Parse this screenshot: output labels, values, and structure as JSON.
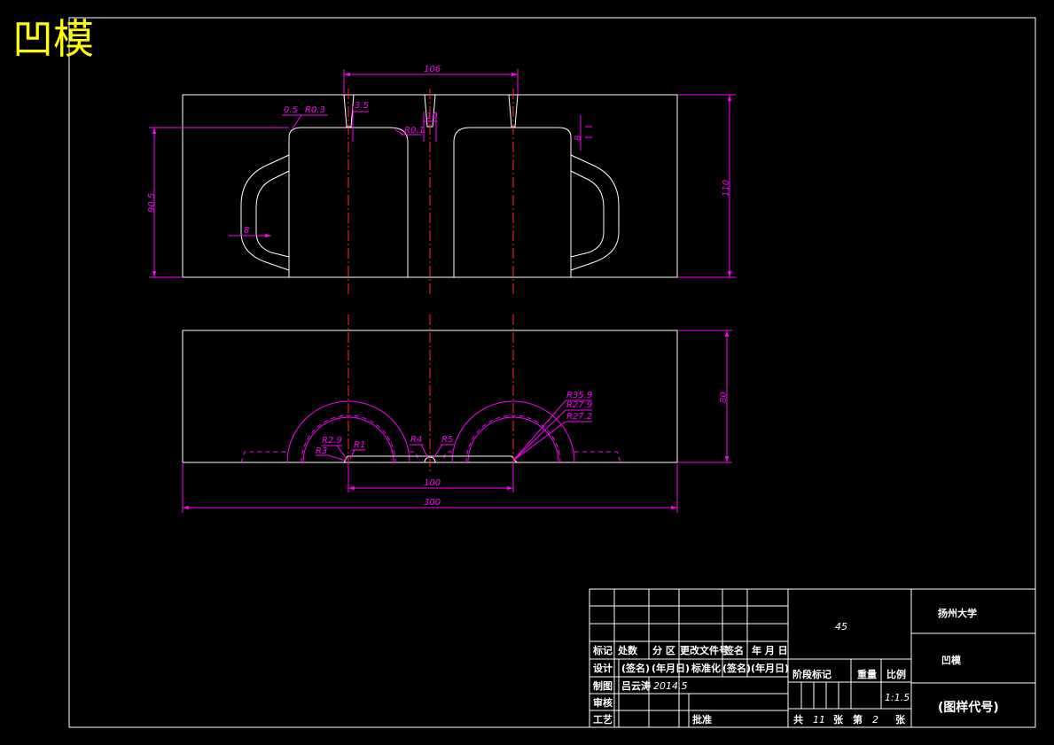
{
  "drawing_title": "凹模",
  "dimensions": {
    "top_width": "106",
    "chamfer": "0.5",
    "r_top": "R0.3",
    "gap_a": "3.5",
    "slot": "10",
    "r_small": "R0.1",
    "rim": "8",
    "height_left": "90.5",
    "height_right": "110",
    "handle": "8",
    "height_bottom": "80",
    "r_outer": "R35.9",
    "r_mid": "R27.9",
    "r_inner": "R27.2",
    "r29": "R2.9",
    "r1": "R1",
    "r3": "R3",
    "r4": "R4",
    "r5": "R5",
    "span": "100",
    "total": "300"
  },
  "title_block": {
    "material": "45",
    "university": "扬州大学",
    "part_name": "凹模",
    "drawing_code": "(图样代号)",
    "hdr_mark": "标记",
    "hdr_count": "处数",
    "hdr_zone": "分 区",
    "hdr_docno": "更改文件号",
    "hdr_sign": "签名",
    "hdr_date": "年 月 日",
    "design_label": "设计",
    "sign_name": "(签名)",
    "ymd": "(年月日)",
    "standard_label": "标准化",
    "sign_name2": "(签名)",
    "ymd2": "(年月日)",
    "drawn_label": "制图",
    "drawn_name": "吕云涛",
    "drawn_date": "2014.5",
    "check_label": "审核",
    "process_label": "工艺",
    "approve_label": "批准",
    "stage_label": "阶段标记",
    "weight_label": "重量",
    "scale_label": "比例",
    "scale_value": "1:1.5",
    "sheet_total_label": "共",
    "sheet_total": "11",
    "sheet_unit": "张",
    "sheet_no_label": "第",
    "sheet_no": "2",
    "sheet_unit2": "张"
  },
  "colors": {
    "outline": "#ffffff",
    "centerline": "#ff2a2a",
    "dimension": "#ff00ff",
    "title": "#ffff00",
    "background": "#000000"
  }
}
